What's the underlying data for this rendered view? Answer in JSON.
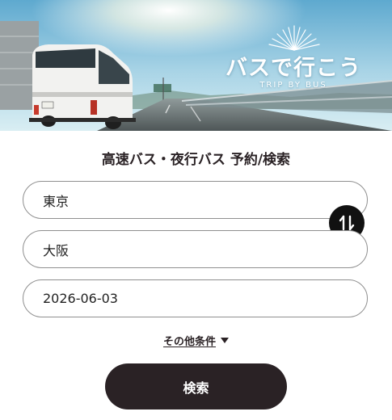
{
  "hero": {
    "title": "バスで行こう",
    "subtitle": "TRIP BY BUS",
    "image_icon": "highway-bus-photo"
  },
  "search": {
    "heading": "高速バス・夜行バス 予約/検索",
    "from_value": "東京",
    "to_value": "大阪",
    "date_value": "2026-06-03",
    "swap_icon": "swap-vertical-icon",
    "more_conditions_label": "その他条件",
    "more_conditions_icon": "caret-down-icon",
    "submit_label": "検索"
  },
  "colors": {
    "primary_dark": "#2a2225",
    "field_border": "#8f8f8f",
    "swap_bg": "#111111"
  }
}
